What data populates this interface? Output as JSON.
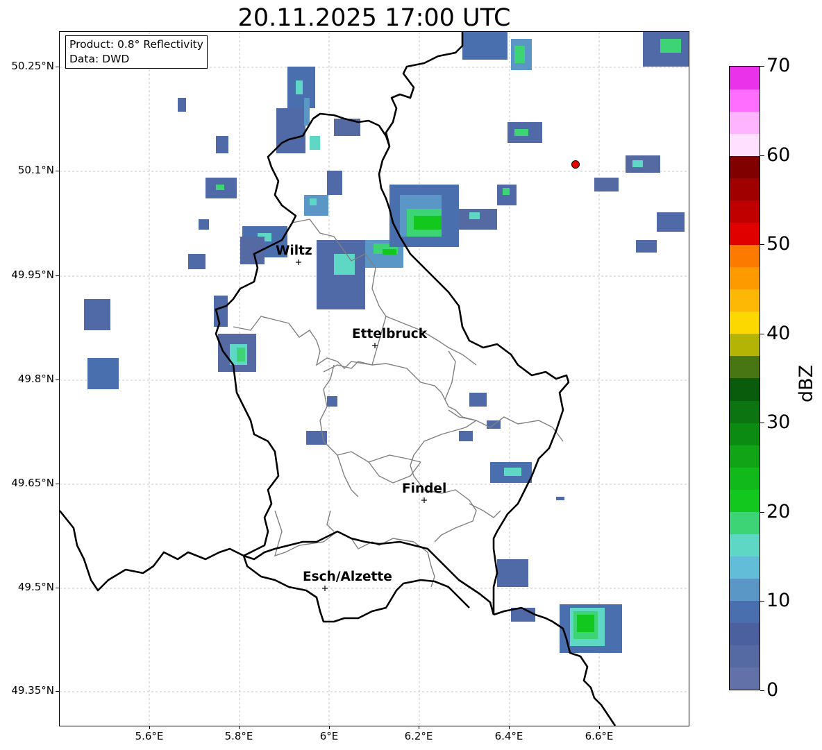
{
  "title": "20.11.2025 17:00 UTC",
  "info": {
    "product": "Product: 0.8° Reflectivity",
    "data": "Data: DWD"
  },
  "axes": {
    "lat_ticks": [
      "50.25°N",
      "50.1°N",
      "49.95°N",
      "49.8°N",
      "49.65°N",
      "49.5°N",
      "49.35°N"
    ],
    "lon_ticks": [
      "5.6°E",
      "5.8°E",
      "6°E",
      "6.2°E",
      "6.4°E",
      "6.6°E"
    ]
  },
  "cities": [
    {
      "name": "Wiltz"
    },
    {
      "name": "Ettelbruck"
    },
    {
      "name": "Findel"
    },
    {
      "name": "Esch/Alzette"
    }
  ],
  "colorbar": {
    "unit": "dBZ",
    "ticks": [
      "0",
      "10",
      "20",
      "30",
      "40",
      "50",
      "60",
      "70"
    ],
    "colors": [
      "#6272a8",
      "#5569a3",
      "#4a609f",
      "#4a6fae",
      "#5a97c6",
      "#62bdd8",
      "#5ed7c5",
      "#3dd475",
      "#12c81e",
      "#11b91a",
      "#10a416",
      "#0c8b12",
      "#0c7410",
      "#0a5c0d",
      "#477612",
      "#b4b405",
      "#fcd700",
      "#fcb805",
      "#fc9a00",
      "#fc7a00",
      "#e00000",
      "#c00000",
      "#a00000",
      "#800000",
      "#ffe1ff",
      "#ffb4ff",
      "#ff6eff",
      "#ea32ea"
    ]
  }
}
